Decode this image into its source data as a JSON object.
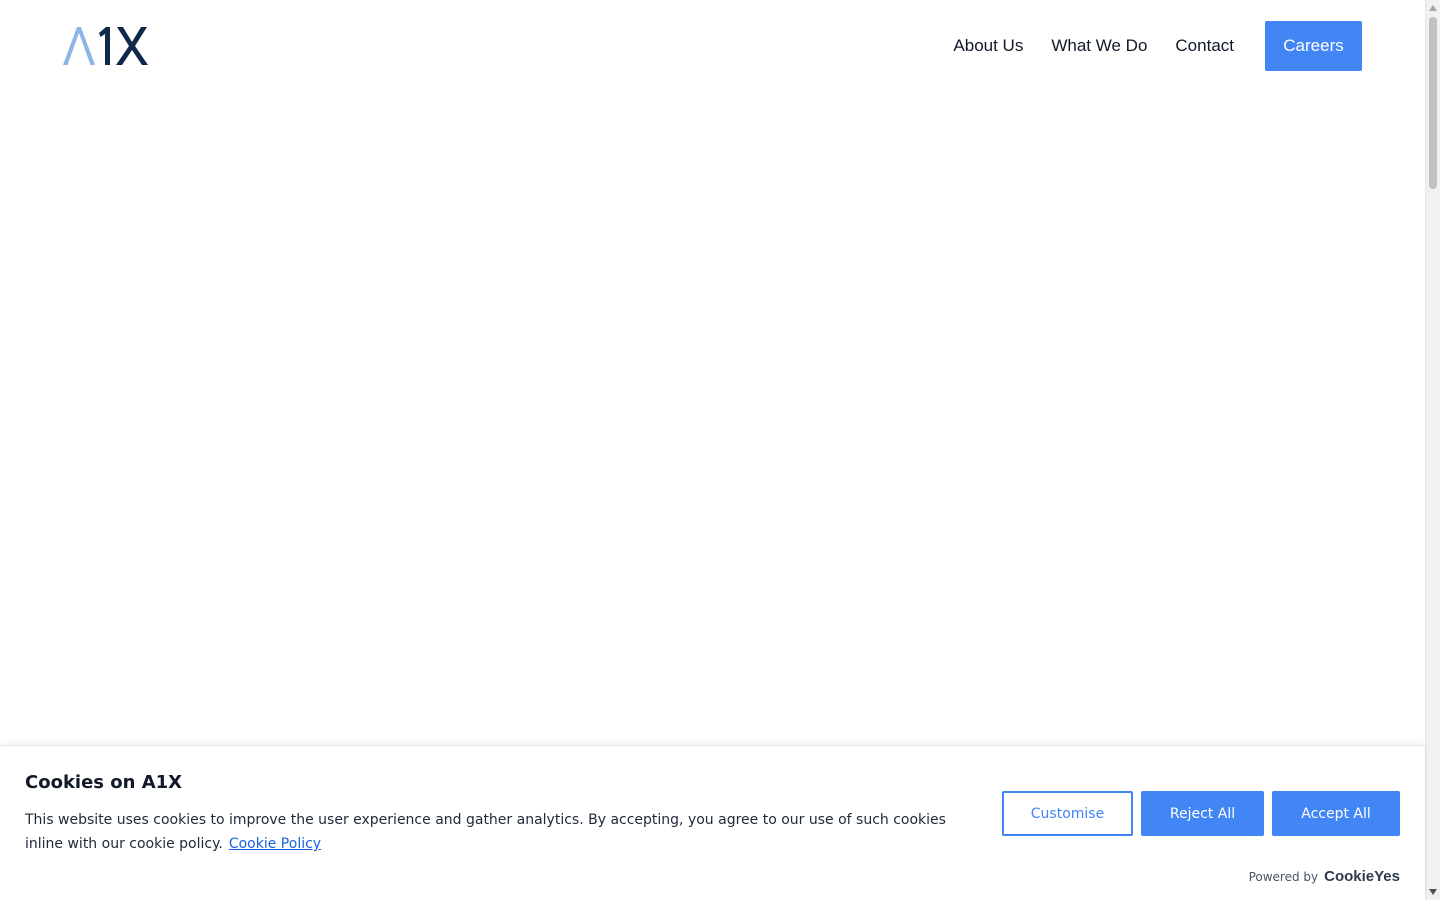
{
  "header": {
    "logo": {
      "letters_light": "A",
      "letters_dark": "1X",
      "light_color": "#8fb5e8",
      "dark_color": "#102a4c"
    },
    "nav": [
      {
        "label": "About Us"
      },
      {
        "label": "What We Do"
      },
      {
        "label": "Contact"
      }
    ],
    "careers_label": "Careers",
    "accent_color": "#4285f4"
  },
  "cookie_banner": {
    "title": "Cookies on A1X",
    "body": "This website uses cookies to improve the user experience and gather analytics. By accepting, you agree to our use of such cookies inline with our cookie policy.",
    "policy_link": "Cookie Policy",
    "customise_label": "Customise",
    "reject_label": "Reject All",
    "accept_label": "Accept All",
    "powered_by_label": "Powered by",
    "powered_by_brand": "CookieYes"
  },
  "icons": {
    "scroll_up": "chevron-up-icon",
    "scroll_down": "chevron-down-icon"
  }
}
